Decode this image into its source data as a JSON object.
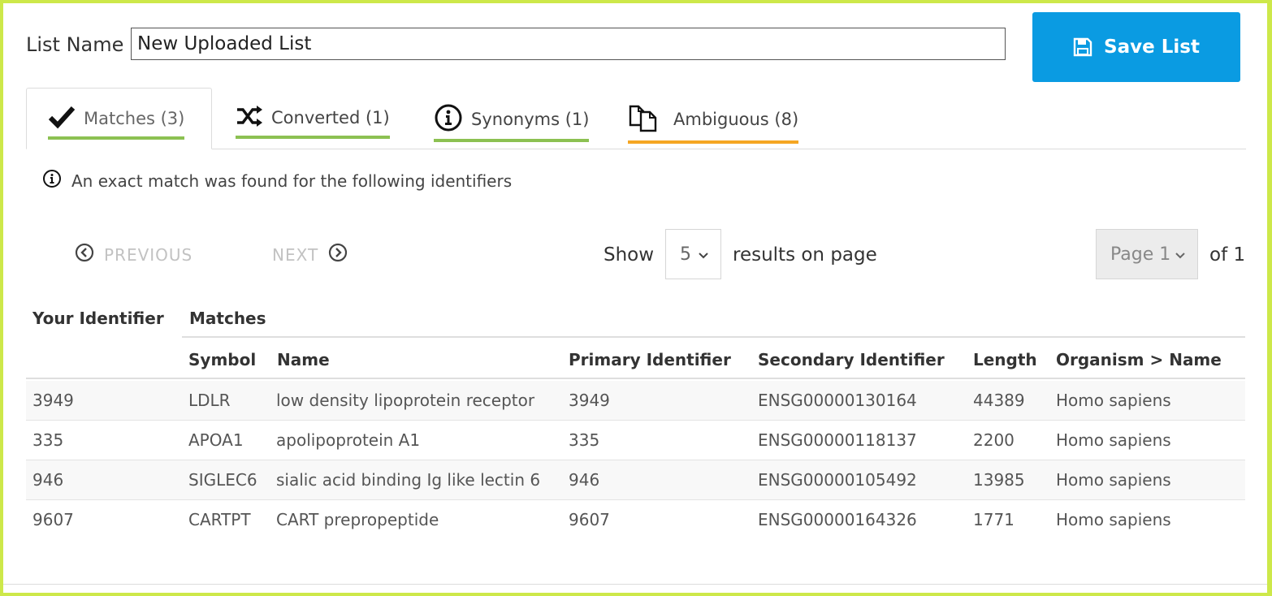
{
  "list_name": {
    "label": "List Name",
    "value": "New Uploaded List"
  },
  "save_button": {
    "label": "Save List",
    "icon": "floppy-disk-icon",
    "color": "#0a9be2"
  },
  "tabs": [
    {
      "label": "Matches (3)",
      "icon": "checkmark-icon",
      "underline_color": "#8cc152",
      "active": true
    },
    {
      "label": "Converted (1)",
      "icon": "shuffle-icon",
      "underline_color": "#8cc152",
      "active": false
    },
    {
      "label": "Synonyms (1)",
      "icon": "info-circle-icon",
      "underline_color": "#8cc152",
      "active": false
    },
    {
      "label": "Ambiguous (8)",
      "icon": "copy-documents-icon",
      "underline_color": "#f5a623",
      "active": false
    }
  ],
  "info_message": "An exact match was found for the following identifiers",
  "pagination": {
    "previous_label": "PREVIOUS",
    "next_label": "NEXT",
    "show_label": "Show",
    "page_size": "5",
    "results_label": "results on page",
    "page_select": "Page 1",
    "of_label": "of 1"
  },
  "table": {
    "identifier_header": "Your Identifier",
    "matches_header": "Matches",
    "columns": [
      "Symbol",
      "Name",
      "Primary Identifier",
      "Secondary Identifier",
      "Length",
      "Organism > Name"
    ],
    "rows": [
      {
        "identifier": "3949",
        "symbol": "LDLR",
        "name": "low density lipoprotein receptor",
        "primary": "3949",
        "secondary": "ENSG00000130164",
        "length": "44389",
        "organism": "Homo sapiens"
      },
      {
        "identifier": "335",
        "symbol": "APOA1",
        "name": "apolipoprotein A1",
        "primary": "335",
        "secondary": "ENSG00000118137",
        "length": "2200",
        "organism": "Homo sapiens"
      },
      {
        "identifier": "946",
        "symbol": "SIGLEC6",
        "name": "sialic acid binding Ig like lectin 6",
        "primary": "946",
        "secondary": "ENSG00000105492",
        "length": "13985",
        "organism": "Homo sapiens"
      },
      {
        "identifier": "9607",
        "symbol": "CARTPT",
        "name": "CART prepropeptide",
        "primary": "9607",
        "secondary": "ENSG00000164326",
        "length": "1771",
        "organism": "Homo sapiens"
      }
    ]
  }
}
